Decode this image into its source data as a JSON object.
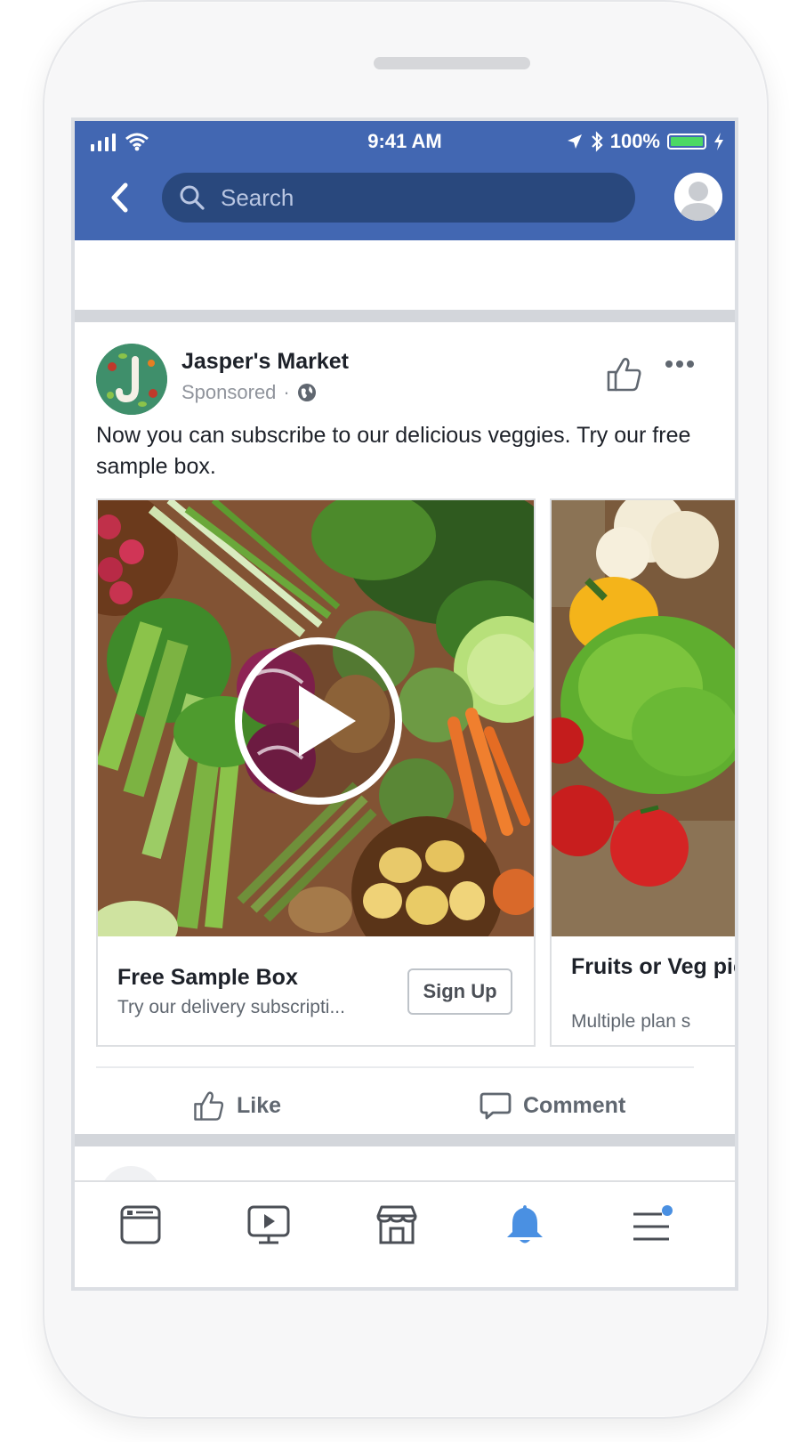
{
  "status_bar": {
    "time": "9:41 AM",
    "battery": "100%"
  },
  "header": {
    "search_placeholder": "Search",
    "icons": [
      "back-arrow-icon",
      "search-icon",
      "profile-avatar"
    ]
  },
  "post": {
    "page_name": "Jasper's Market",
    "sponsored": "Sponsored",
    "separator": "·",
    "text": "Now you can subscribe to our delicious veggies. Try our free sample box.",
    "cards": [
      {
        "title": "Free Sample Box",
        "subtitle": "Try our delivery subscripti...",
        "button": "Sign Up"
      },
      {
        "title": "Fruits or Veg pick",
        "subtitle": "Multiple plan s"
      }
    ],
    "actions": {
      "like": "Like",
      "comment": "Comment"
    }
  },
  "tab_bar": {
    "tabs": [
      "news-feed",
      "watch",
      "marketplace",
      "notifications",
      "menu"
    ],
    "active": "notifications"
  },
  "colors": {
    "header_blue": "#4267b2",
    "search_bg": "#29487d",
    "active_tab": "#4a90e2",
    "separator": "#d3d6db"
  }
}
